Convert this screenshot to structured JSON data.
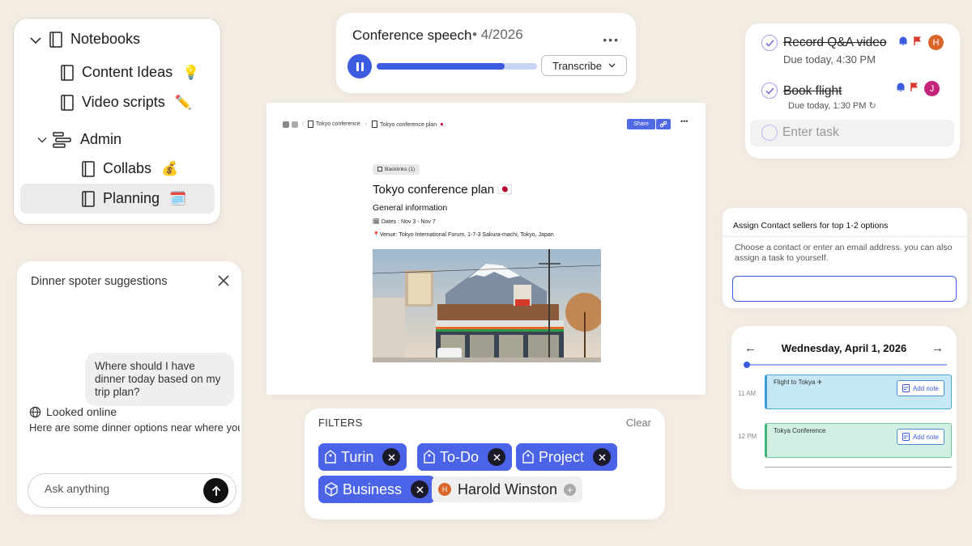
{
  "notebooks": {
    "root": "Notebooks",
    "items": [
      {
        "label": "Content Ideas",
        "emoji": "💡"
      },
      {
        "label": "Video scripts",
        "emoji": "✏️"
      }
    ],
    "admin": "Admin",
    "admin_items": [
      {
        "label": "Collabs",
        "emoji": "💰"
      },
      {
        "label": "Planning",
        "emoji": "🗓️"
      }
    ]
  },
  "chat": {
    "title": "Dinner spoter suggestions",
    "user_message": "Where should I have dinner today based on my trip plan?",
    "status": "Looked online",
    "answer": "Here are some dinner options near where you",
    "input_placeholder": "Ask anything"
  },
  "speech": {
    "title": "Conference speech",
    "date": "4/2026",
    "progress": 0.8,
    "transcribe_label": "Transcribe",
    "accent": "#3b5be0"
  },
  "doc": {
    "breadcrumb": [
      "Tokyo conference",
      "Tokyo conference plan 🇯🇵"
    ],
    "share_label": "Share",
    "backlinks": "Backlinks (1)",
    "title": "Tokyo conference plan 🇯🇵",
    "section": "General information",
    "dates": "Dates : Nov 3 - Nov 7",
    "venue": "Venue: Tokyo International Forum, 1-7-3 Sakura-machi, Tokyo, Japan"
  },
  "filters": {
    "title": "FILTERS",
    "clear": "Clear",
    "chips": [
      "Turin",
      "To-Do",
      "Project",
      "Business"
    ],
    "person": {
      "initial": "H",
      "name": "Harold Winston"
    }
  },
  "tasks": {
    "items": [
      {
        "title": "Record Q&A video",
        "due": "Due today, 4:30 PM",
        "avatar": "H"
      },
      {
        "title": "Book flight",
        "due": "Due today, 1:30 PM",
        "avatar": "J"
      }
    ],
    "placeholder": "Enter task"
  },
  "assign": {
    "title": "Assign Contact sellers for top 1-2 options",
    "description": "Choose a contact or enter an email address. you can also assign a task to yourself.",
    "email_value": ""
  },
  "calendar": {
    "date": "Wednesday, April 1, 2026",
    "times": [
      "11 AM",
      "12 PM"
    ],
    "events": [
      {
        "title": "Flight to Tokya ✈",
        "action": "Add note"
      },
      {
        "title": "Tokya Conference",
        "action": "Add note"
      }
    ]
  }
}
